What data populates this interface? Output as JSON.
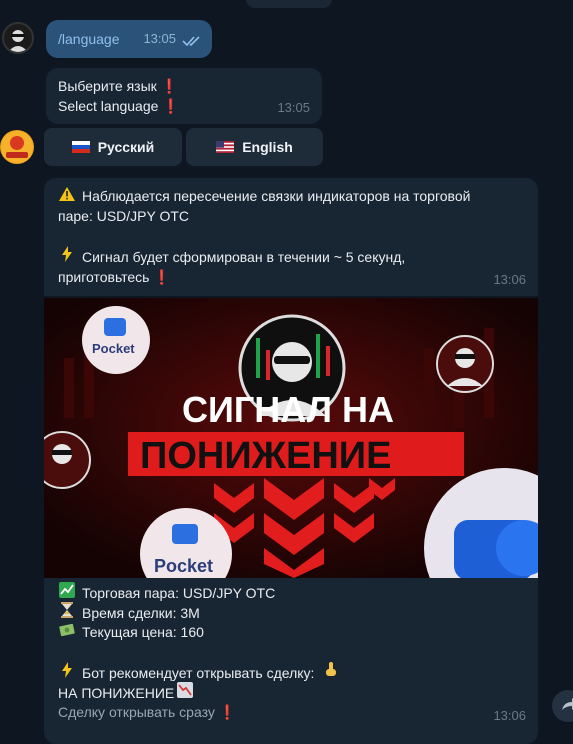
{
  "out_message": {
    "text": "/language",
    "time": "13:05"
  },
  "lang_message": {
    "line1": "Выберите язык",
    "line2": "Select language",
    "mark": "❗",
    "time": "13:05"
  },
  "keyboard": {
    "russian": "Русский",
    "english": "English"
  },
  "signal_message": {
    "line1": "Наблюдается пересечение связки индикаторов на торговой",
    "line2": "паре: USD/JPY OTC",
    "line3": "Сигнал будет сформирован в течении ~ 5 секунд,",
    "line4": "приготовьтесь",
    "time": "13:06"
  },
  "promo": {
    "title_white": "СИГНАЛ НА",
    "title_red": "ПОНИЖЕНИЕ",
    "badge_text": "Pocket"
  },
  "caption": {
    "pair": "Торговая пара: USD/JPY OTC",
    "duration": "Время сделки: 3M",
    "price": "Текущая цена: 160",
    "recommend": "Бот рекомендует открывать сделку:",
    "direction": "НА ПОНИЖЕНИЕ",
    "open_now": "Сделку открывать сразу",
    "time": "13:06"
  },
  "colors": {
    "background": "#0e1621",
    "incoming": "#182533",
    "outgoing": "#2b5278",
    "accent_red": "#e8322e"
  },
  "icons": [
    "double-check-icon",
    "warning-icon",
    "lightning-icon",
    "chart-up-icon",
    "hourglass-icon",
    "money-icon",
    "point-down-icon",
    "chart-down-icon",
    "forward-icon"
  ]
}
